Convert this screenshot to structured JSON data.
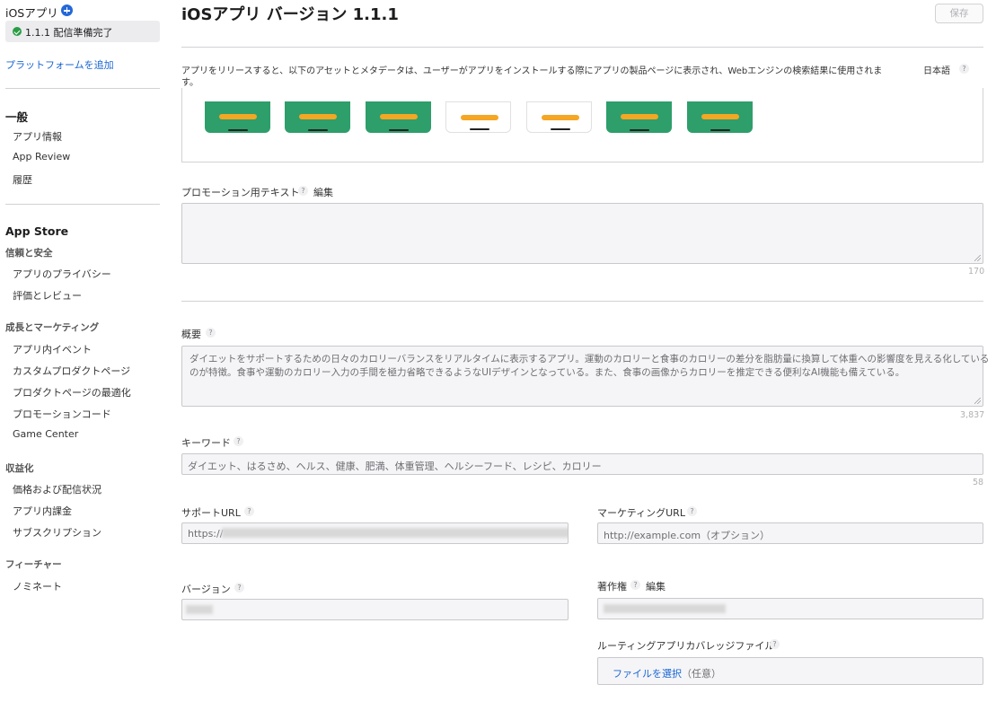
{
  "sidebar": {
    "app_title": "iOSアプリ",
    "version_status": "1.1.1 配信準備完了",
    "add_platform": "プラットフォームを追加",
    "general": {
      "heading": "一般",
      "items": [
        "アプリ情報",
        "App Review",
        "履歴"
      ]
    },
    "app_store": {
      "heading": "App Store",
      "groups": [
        {
          "title": "信頼と安全",
          "items": [
            "アプリのプライバシー",
            "評価とレビュー"
          ]
        },
        {
          "title": "成長とマーケティング",
          "items": [
            "アプリ内イベント",
            "カスタムプロダクトページ",
            "プロダクトページの最適化",
            "プロモーションコード",
            "Game Center"
          ]
        },
        {
          "title": "収益化",
          "items": [
            "価格および配信状況",
            "アプリ内課金",
            "サブスクリプション"
          ]
        },
        {
          "title": "フィーチャー",
          "items": [
            "ノミネート"
          ]
        }
      ]
    }
  },
  "header": {
    "title": "iOSアプリ バージョン 1.1.1",
    "save_label": "保存"
  },
  "intro": {
    "text_line1": "アプリをリリースすると、以下のアセットとメタデータは、ユーザーがアプリをインストールする際にアプリの製品ページに表示され、Webエンジンの検索結果に使用されま",
    "text_line2": "す。",
    "language": "日本語"
  },
  "screenshots": [
    {
      "style": "green"
    },
    {
      "style": "green"
    },
    {
      "style": "green"
    },
    {
      "style": "white"
    },
    {
      "style": "white"
    },
    {
      "style": "green"
    },
    {
      "style": "green"
    }
  ],
  "promo": {
    "label": "プロモーション用テキスト",
    "edit": "編集",
    "value": "",
    "counter": "170"
  },
  "description": {
    "label": "概要",
    "line1": "ダイエットをサポートするための日々のカロリーバランスをリアルタイムに表示するアプリ。運動のカロリーと食事のカロリーの差分を脂肪量に換算して体重への影響度を見える化している",
    "line2": "のが特徴。食事や運動のカロリー入力の手間を極力省略できるようなUIデザインとなっている。また、食事の画像からカロリーを推定できる便利なAI機能も備えている。",
    "counter": "3,837"
  },
  "keywords": {
    "label": "キーワード",
    "value": "ダイエット、はるさめ、ヘルス、健康、肥満、体重管理、ヘルシーフード、レシピ、カロリー",
    "counter": "58"
  },
  "support_url": {
    "label": "サポートURL",
    "value": "https://"
  },
  "marketing_url": {
    "label": "マーケティングURL",
    "placeholder": "http://example.com（オプション）"
  },
  "version": {
    "label": "バージョン"
  },
  "copyright": {
    "label": "著作権",
    "edit": "編集"
  },
  "routing": {
    "label": "ルーティングアプリカバレッジファイル",
    "choose_file": "ファイルを選択",
    "optional": "（任意）"
  },
  "icons": {
    "add": "plus-circle-icon",
    "status": "checkmark-circle-icon",
    "help": "question-mark-icon"
  },
  "colors": {
    "link": "#1a66d2",
    "status_green": "#2a9c45",
    "screenshot_green": "#2e9e6b",
    "accent_orange": "#f5a623"
  }
}
